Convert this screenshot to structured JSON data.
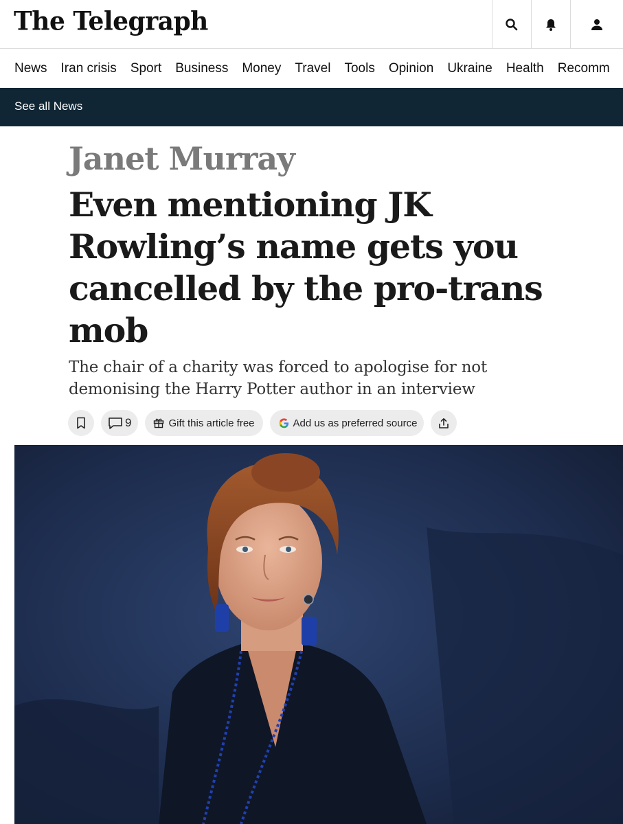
{
  "masthead": {
    "logo": "The Telegraph",
    "icons": [
      "search-icon",
      "bell-icon",
      "user-icon"
    ]
  },
  "nav": {
    "items": [
      "News",
      "Iran crisis",
      "Sport",
      "Business",
      "Money",
      "Travel",
      "Tools",
      "Opinion",
      "Ukraine",
      "Health",
      "Recomm"
    ]
  },
  "subbar": {
    "label": "See all News"
  },
  "article": {
    "author": "Janet Murray",
    "headline": "Even mentioning JK Rowling’s name gets you cancelled by the pro-trans mob",
    "standfirst": "The chair of a charity was forced to apologise for not demonising the Harry Potter author in an interview"
  },
  "actions": {
    "bookmark_icon": "bookmark-icon",
    "comments_count": "9",
    "gift_label": "Gift this article free",
    "preferred_source_label": "Add us as preferred source",
    "share_icon": "share-icon"
  },
  "colors": {
    "subbar_bg": "#112635",
    "author_grey": "#7a7a7a",
    "pill_bg": "#ececec"
  }
}
